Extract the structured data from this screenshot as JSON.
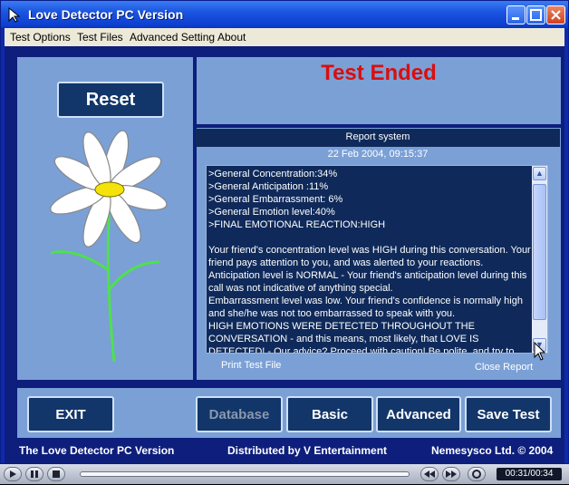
{
  "window": {
    "title": "Love Detector PC Version"
  },
  "menu": [
    "Test Options",
    "Test Files",
    "Advanced Setting",
    "About"
  ],
  "left_panel": {
    "reset_label": "Reset"
  },
  "status": {
    "title": "Test Ended",
    "title_color": "#d80f0f"
  },
  "report": {
    "header": "Report system",
    "date": "22 Feb 2004, 09:15:37",
    "lines": [
      ">General Concentration:34%",
      ">General Anticipation :11%",
      ">General Embarrassment: 6%",
      ">General Emotion level:40%",
      ">FINAL EMOTIONAL REACTION:HIGH",
      "",
      "Your friend's concentration level was HIGH during this conversation. Your friend pays attention to you, and was alerted to your reactions.",
      "Anticipation level is NORMAL - Your friend's anticipation level during this call was not indicative of anything special.",
      "Embarrassment level was low. Your friend's confidence is normally high and she/he was not too embarrassed to speak with you.",
      "HIGH EMOTIONS WERE DETECTED THROUGHOUT THE CONVERSATION - and this means, most likely, that LOVE IS DETECTED! - Our advice? Proceed with caution! Be polite, and try to make the first move!"
    ],
    "print_label": "Print Test File",
    "close_label": "Close Report"
  },
  "bottom_buttons": {
    "exit": "EXIT",
    "database": "Database",
    "basic": "Basic",
    "advanced": "Advanced",
    "save": "Save Test"
  },
  "footer": {
    "left": "The Love Detector PC Version",
    "center": "Distributed by V Entertainment",
    "right": "Nemesysco Ltd. © 2004"
  },
  "player": {
    "time": "00:31/00:34"
  }
}
